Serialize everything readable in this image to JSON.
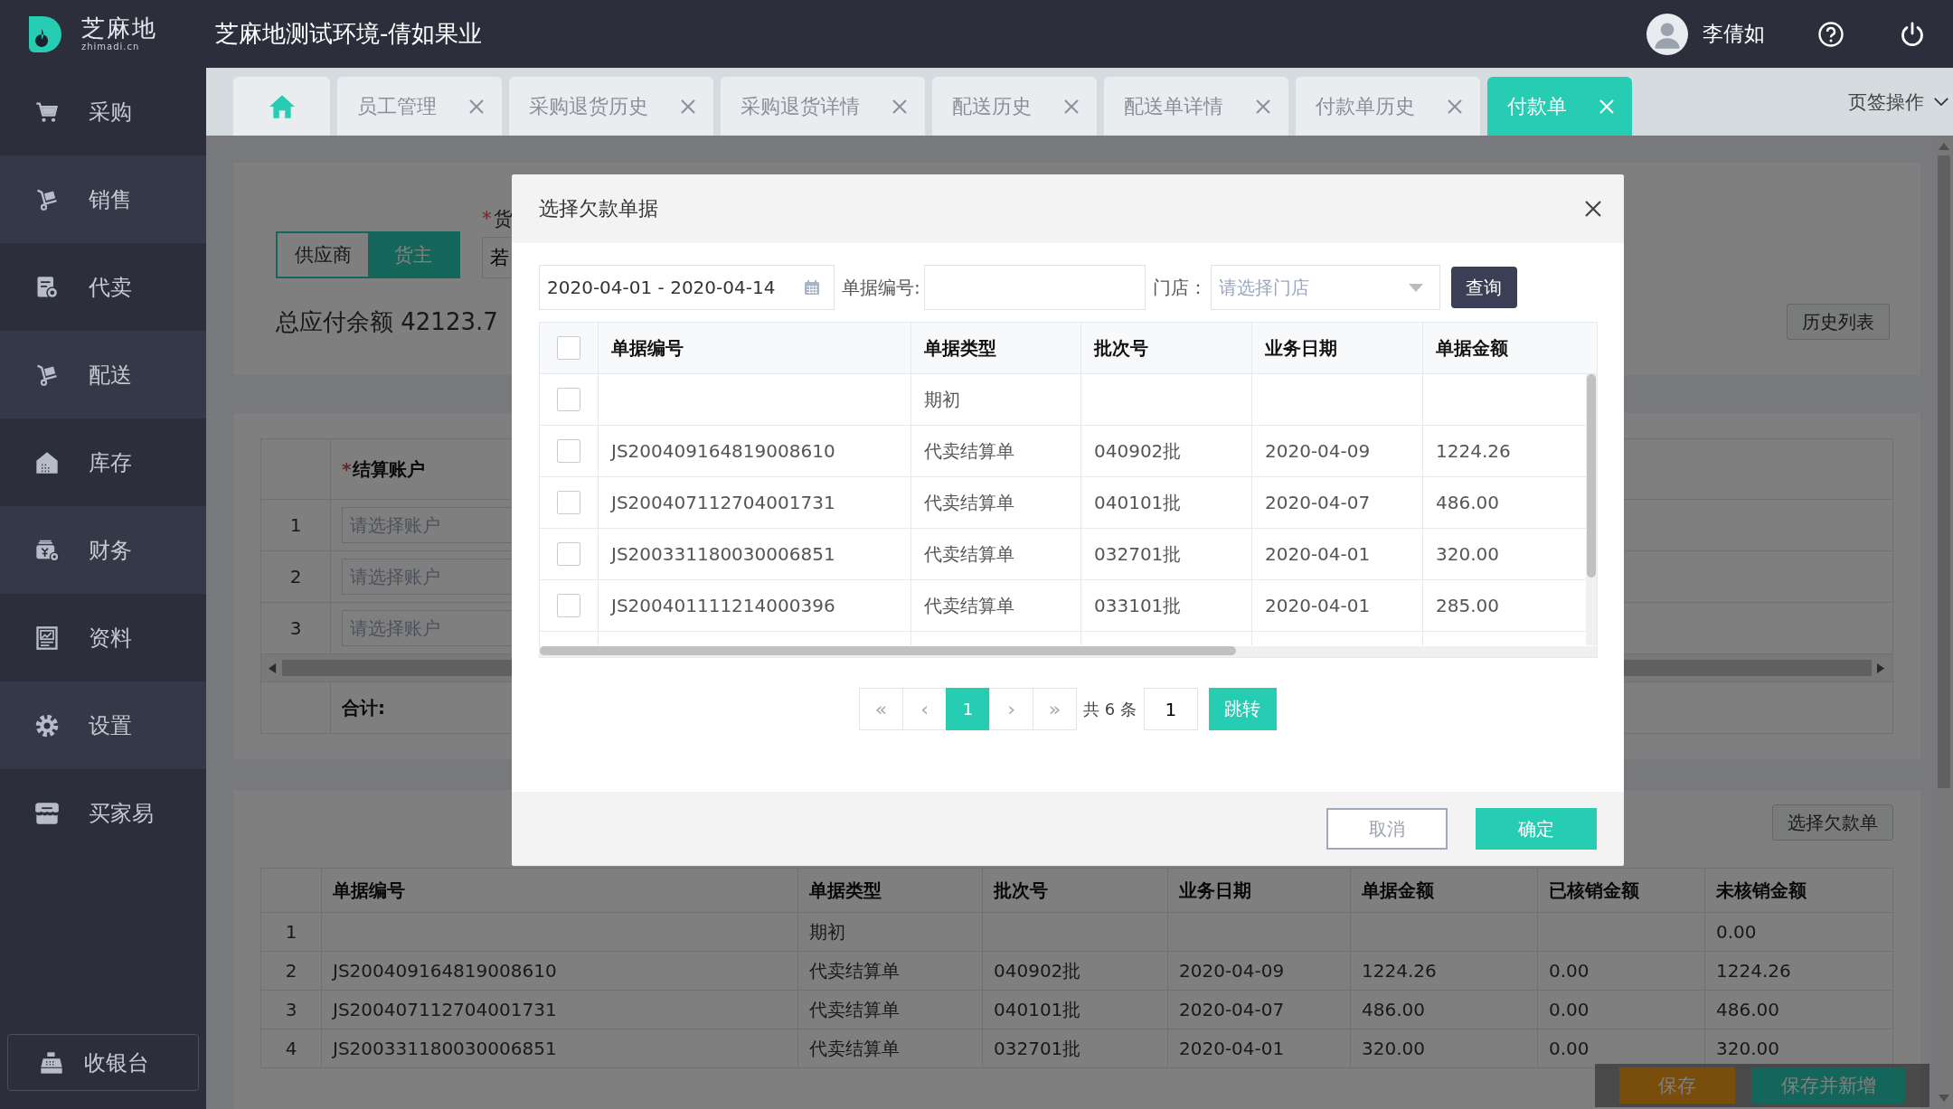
{
  "header": {
    "logo_text": "芝麻地",
    "logo_subtext": "zhimadi.cn",
    "title": "芝麻地测试环境-倩如果业",
    "user": "李倩如"
  },
  "sidebar": {
    "items": [
      {
        "label": "采购"
      },
      {
        "label": "销售"
      },
      {
        "label": "代卖"
      },
      {
        "label": "配送"
      },
      {
        "label": "库存"
      },
      {
        "label": "财务"
      },
      {
        "label": "资料"
      },
      {
        "label": "设置"
      },
      {
        "label": "买家易"
      }
    ],
    "cashier": "收银台"
  },
  "tabs": [
    {
      "kind": "home",
      "selected": false
    },
    {
      "kind": "page",
      "label": "员工管理",
      "selected": false
    },
    {
      "kind": "page",
      "label": "采购退货历史",
      "selected": false
    },
    {
      "kind": "page",
      "label": "采购退货详情",
      "selected": false
    },
    {
      "kind": "page",
      "label": "配送历史",
      "selected": false
    },
    {
      "kind": "page",
      "label": "配送单详情",
      "selected": false
    },
    {
      "kind": "page",
      "label": "付款单历史",
      "selected": false
    },
    {
      "kind": "page",
      "label": "付款单",
      "selected": true
    }
  ],
  "tab_menu": "页签操作",
  "page": {
    "partner_types": [
      {
        "label": "供应商",
        "selected": false
      },
      {
        "label": "货主",
        "selected": true
      }
    ],
    "required_mark": "*",
    "partner_label": "货",
    "partner_value": "若",
    "balance": "总应付余额 42123.7",
    "history_button": "历史列表",
    "accounts_table": {
      "required_mark": "*",
      "column": "结算账户",
      "rows": [
        {
          "index": "1",
          "placeholder": "请选择账户"
        },
        {
          "index": "2",
          "placeholder": "请选择账户"
        },
        {
          "index": "3",
          "placeholder": "请选择账户"
        }
      ],
      "total_label": "合计:"
    },
    "bills_button": "选择欠款单",
    "bills_table": {
      "columns": [
        "单据编号",
        "单据类型",
        "批次号",
        "业务日期",
        "单据金额",
        "已核销金额",
        "未核销金额"
      ],
      "rows": [
        {
          "index": "1",
          "cells": [
            null,
            "期初",
            null,
            null,
            null,
            null,
            "0.00"
          ]
        },
        {
          "index": "2",
          "cells": [
            "JS200409164819008610",
            "代卖结算单",
            "040902批",
            "2020-04-09",
            "1224.26",
            "0.00",
            "1224.26"
          ]
        },
        {
          "index": "3",
          "cells": [
            "JS200407112704001731",
            "代卖结算单",
            "040101批",
            "2020-04-07",
            "486.00",
            "0.00",
            "486.00"
          ]
        },
        {
          "index": "4",
          "cells": [
            "JS200331180030006851",
            "代卖结算单",
            "032701批",
            "2020-04-01",
            "320.00",
            "0.00",
            "320.00"
          ]
        }
      ]
    },
    "actions": [
      {
        "kind": "warning",
        "label": "保存"
      },
      {
        "kind": "primary",
        "label": "保存并新增"
      }
    ]
  },
  "dialog": {
    "title": "选择欠款单据",
    "date_range": "2020-04-01 - 2020-04-14",
    "number_label": "单据编号:",
    "store_label": "门店：",
    "store_placeholder": "请选择门店",
    "query_button": "查询",
    "table": {
      "select_all_checked": false,
      "columns": [
        "单据编号",
        "单据类型",
        "批次号",
        "业务日期",
        "单据金额"
      ],
      "rows": [
        {
          "checked": false,
          "cells": [
            null,
            "期初",
            null,
            null,
            null
          ]
        },
        {
          "checked": false,
          "cells": [
            "JS200409164819008610",
            "代卖结算单",
            "040902批",
            "2020-04-09",
            "1224.26"
          ]
        },
        {
          "checked": false,
          "cells": [
            "JS200407112704001731",
            "代卖结算单",
            "040101批",
            "2020-04-07",
            "486.00"
          ]
        },
        {
          "checked": false,
          "cells": [
            "JS200331180030006851",
            "代卖结算单",
            "032701批",
            "2020-04-01",
            "320.00"
          ]
        },
        {
          "checked": false,
          "cells": [
            "JS200401111214000396",
            "代卖结算单",
            "033101批",
            "2020-04-01",
            "285.00"
          ]
        }
      ]
    },
    "pagination": {
      "first": "«",
      "prev": "‹",
      "pages": [
        {
          "label": "1",
          "selected": true
        }
      ],
      "next": "›",
      "last": "»",
      "total": "共 6 条",
      "page_input": "1",
      "jump_button": "跳转"
    },
    "cancel_button": "取消",
    "confirm_button": "确定"
  }
}
